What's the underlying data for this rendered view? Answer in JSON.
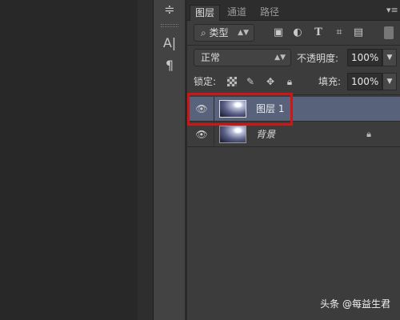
{
  "tabs": [
    "图层",
    "通道",
    "路径"
  ],
  "filter": {
    "label": "类型",
    "icons": [
      "image-filter-icon",
      "adjustment-filter-icon",
      "type-filter-icon",
      "shape-filter-icon",
      "smart-object-filter-icon",
      "filter-toggle-icon"
    ]
  },
  "blend": {
    "mode": "正常",
    "opacity_label": "不透明度:",
    "opacity_value": "100%"
  },
  "lock": {
    "label": "锁定:",
    "fill_label": "填充:",
    "fill_value": "100%",
    "icons": [
      "lock-transparent-icon",
      "lock-paint-icon",
      "lock-position-icon",
      "lock-all-icon"
    ]
  },
  "layers": [
    {
      "name": "图层 1",
      "visible": true,
      "selected": true
    },
    {
      "name": "背景",
      "visible": true,
      "selected": false,
      "locked": true
    }
  ],
  "toolbar": {
    "tools": [
      "paragraph-panel-icon",
      "character-panel-icon",
      "paragraph-mark-icon"
    ],
    "char_glyph": "A|",
    "para_glyph": "¶"
  },
  "watermark": "头条 @每益生君",
  "colors": {
    "panel_bg": "#3c3c3c",
    "selected_row": "#58637b",
    "highlight": "#d01515"
  }
}
